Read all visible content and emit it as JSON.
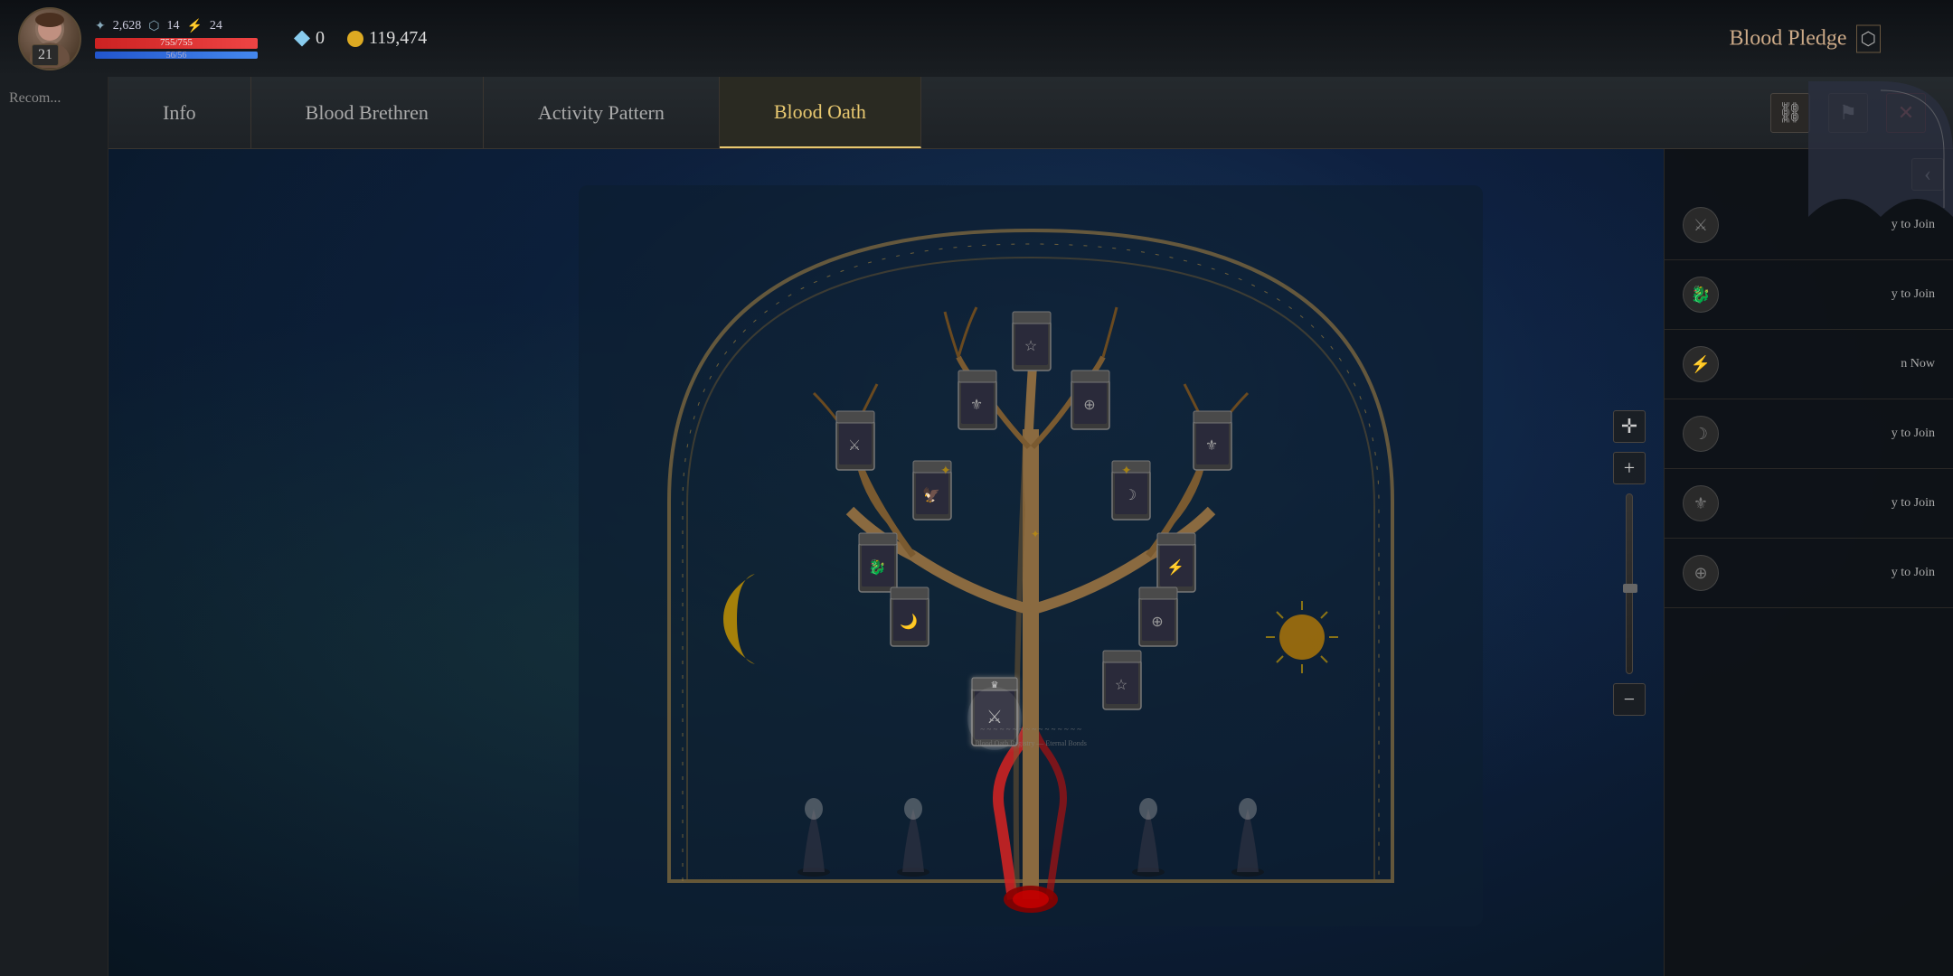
{
  "hud": {
    "level": "21",
    "avatar_label": "👤",
    "stats": {
      "sword_icon": "⚔",
      "sword_val": "2,628",
      "shield_icon": "🛡",
      "shield_val": "14",
      "boot_icon": "👢",
      "boot_val": "24"
    },
    "hp": "755/755",
    "mp": "56/56"
  },
  "currency": {
    "diamond_label": "0",
    "gold_label": "119,474"
  },
  "blood_pledge": {
    "label": "Blood Pledge",
    "icon": "↗"
  },
  "tabs": [
    {
      "id": "info",
      "label": "Info",
      "active": false
    },
    {
      "id": "blood-brethren",
      "label": "Blood Brethren",
      "active": false
    },
    {
      "id": "activity-pattern",
      "label": "Activity Pattern",
      "active": false
    },
    {
      "id": "blood-oath",
      "label": "Blood Oath",
      "active": true
    }
  ],
  "tab_icons": {
    "link_icon": "🔗",
    "flag_icon": "🏴",
    "close_icon": "✕"
  },
  "left_panel": {
    "recommend_text": "Recom..."
  },
  "right_sidebar": {
    "sections": [
      {
        "id": 1,
        "join_text": "y to Join"
      },
      {
        "id": 2,
        "join_text": "y to Join"
      },
      {
        "id": 3,
        "join_text": "n Now"
      },
      {
        "id": 4,
        "join_text": "y to Join"
      },
      {
        "id": 5,
        "join_text": "y to Join"
      },
      {
        "id": 6,
        "join_text": "y to Join"
      }
    ]
  },
  "zoom_controls": {
    "plus_label": "+",
    "move_label": "✛",
    "minus_label": "−"
  },
  "back_arrow": "‹"
}
